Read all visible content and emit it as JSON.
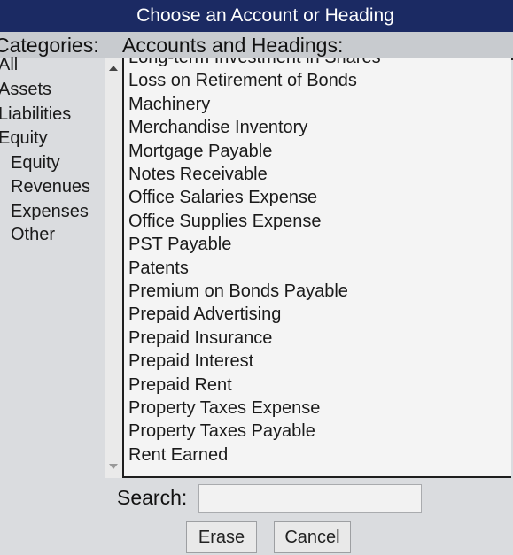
{
  "window": {
    "title": "Choose an Account or Heading"
  },
  "headers": {
    "categories": "Categories:",
    "accounts": "Accounts and Headings:"
  },
  "categories": [
    {
      "label": "All",
      "indent": 0
    },
    {
      "label": "Assets",
      "indent": 0
    },
    {
      "label": "Liabilities",
      "indent": 0
    },
    {
      "label": "Equity",
      "indent": 0
    },
    {
      "label": "Equity",
      "indent": 1
    },
    {
      "label": "Revenues",
      "indent": 1
    },
    {
      "label": "Expenses",
      "indent": 1
    },
    {
      "label": "Other",
      "indent": 1
    }
  ],
  "accounts": [
    "Long-term Investment in Shares",
    "Loss on Retirement of Bonds",
    "Machinery",
    "Merchandise Inventory",
    "Mortgage Payable",
    "Notes Receivable",
    "Office Salaries Expense",
    "Office Supplies Expense",
    "PST Payable",
    "Patents",
    "Premium on Bonds Payable",
    "Prepaid Advertising",
    "Prepaid Insurance",
    "Prepaid Interest",
    "Prepaid Rent",
    "Property Taxes Expense",
    "Property Taxes Payable",
    "Rent Earned"
  ],
  "search": {
    "label": "Search:",
    "value": "",
    "placeholder": ""
  },
  "buttons": {
    "erase": "Erase",
    "cancel": "Cancel"
  },
  "icons": {
    "scroll_up": "triangle-up-icon",
    "scroll_down": "triangle-down-icon"
  }
}
